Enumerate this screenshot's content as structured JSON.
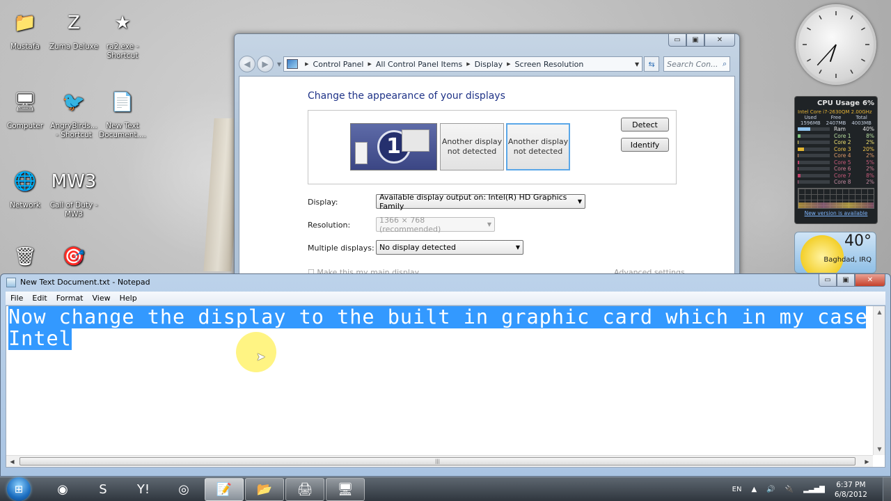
{
  "desktop": {
    "icons": [
      {
        "label": "Mustafa",
        "icon": "user-folder-icon",
        "glyph": "📁"
      },
      {
        "label": "Zuma Deluxe",
        "icon": "zuma-icon",
        "glyph": "Z"
      },
      {
        "label": "ra2.exe - Shortcut",
        "icon": "ra2-icon",
        "glyph": "★"
      },
      {
        "label": "Computer",
        "icon": "computer-icon",
        "glyph": "🖥"
      },
      {
        "label": "AngryBirds... - Shortcut",
        "icon": "angry-birds-icon",
        "glyph": "🐦"
      },
      {
        "label": "New Text Document....",
        "icon": "text-file-icon",
        "glyph": "📄"
      },
      {
        "label": "Network",
        "icon": "network-icon",
        "glyph": "🌐"
      },
      {
        "label": "Call of Duty - MW3",
        "icon": "call-of-duty-icon",
        "glyph": "MW3"
      },
      {
        "label": "",
        "icon": "recycle-bin-icon",
        "glyph": "🗑"
      },
      {
        "label": "",
        "icon": "counter-strike-icon",
        "glyph": "🎯"
      }
    ]
  },
  "display_window": {
    "breadcrumbs": [
      "Control Panel",
      "All Control Panel Items",
      "Display",
      "Screen Resolution"
    ],
    "search_placeholder": "Search Con...",
    "heading": "Change the appearance of your displays",
    "monitors": [
      {
        "label": "1"
      },
      {
        "label": "Another display not detected"
      },
      {
        "label": "Another display not detected"
      }
    ],
    "detect_label": "Detect",
    "identify_label": "Identify",
    "display_label": "Display:",
    "display_value": "Available display output on: Intel(R) HD Graphics Family",
    "resolution_label": "Resolution:",
    "resolution_value": "1366 × 768 (recommended)",
    "multiple_label": "Multiple displays:",
    "multiple_value": "No display detected",
    "main_display_label": "Make this my main display",
    "advanced_label": "Advanced settings"
  },
  "clock_widget": {
    "hour": 6,
    "minute": 37
  },
  "cpu_widget": {
    "title": "CPU Usage",
    "total": "6%",
    "model": "Intel Core i7-2630QM 2.00GHz",
    "mem_headers": [
      "Used",
      "Free",
      "Total"
    ],
    "mem_values": [
      "1596MB",
      "2407MB",
      "4003MB"
    ],
    "rows": [
      {
        "label": "Ram",
        "value": "40%",
        "pct": 40,
        "color": "#8ec3ef",
        "text": "#e6e6e6"
      },
      {
        "label": "Core 1",
        "value": "8%",
        "pct": 8,
        "color": "#7dc27d",
        "text": "#b9e0a0"
      },
      {
        "label": "Core 2",
        "value": "2%",
        "pct": 2,
        "color": "#e8d35a",
        "text": "#f0e070"
      },
      {
        "label": "Core 3",
        "value": "20%",
        "pct": 20,
        "color": "#e3b531",
        "text": "#f0c44a"
      },
      {
        "label": "Core 4",
        "value": "2%",
        "pct": 2,
        "color": "#d88a5a",
        "text": "#e09a6a"
      },
      {
        "label": "Core 5",
        "value": "5%",
        "pct": 5,
        "color": "#c2426b",
        "text": "#c85a7a"
      },
      {
        "label": "Core 6",
        "value": "2%",
        "pct": 2,
        "color": "#c2426b",
        "text": "#d07a90"
      },
      {
        "label": "Core 7",
        "value": "8%",
        "pct": 8,
        "color": "#c2426b",
        "text": "#c85a7a"
      },
      {
        "label": "Core 8",
        "value": "2%",
        "pct": 2,
        "color": "#b25a7a",
        "text": "#c48aa0"
      }
    ],
    "link": "New version is available"
  },
  "weather_widget": {
    "temp": "40°",
    "location": "Baghdad, IRQ"
  },
  "notepad": {
    "title": "New Text Document.txt - Notepad",
    "menu": [
      "File",
      "Edit",
      "Format",
      "View",
      "Help"
    ],
    "lines": [
      "Now change the display to the built in graphic card which in my case i",
      "Intel"
    ]
  },
  "taskbar": {
    "items": [
      {
        "name": "app-icon",
        "glyph": "◉",
        "open": false
      },
      {
        "name": "skype-icon",
        "glyph": "S",
        "open": false
      },
      {
        "name": "yahoo-messenger-icon",
        "glyph": "Y!",
        "open": false
      },
      {
        "name": "chrome-icon",
        "glyph": "◎",
        "open": false
      },
      {
        "name": "notepad-icon",
        "glyph": "📝",
        "open": true,
        "active": true
      },
      {
        "name": "explorer-icon",
        "glyph": "📂",
        "open": true
      },
      {
        "name": "devices-icon",
        "glyph": "🖨",
        "open": true
      },
      {
        "name": "control-panel-icon",
        "glyph": "🖥",
        "open": true
      }
    ],
    "language": "EN",
    "time": "6:37 PM",
    "date": "6/8/2012"
  }
}
